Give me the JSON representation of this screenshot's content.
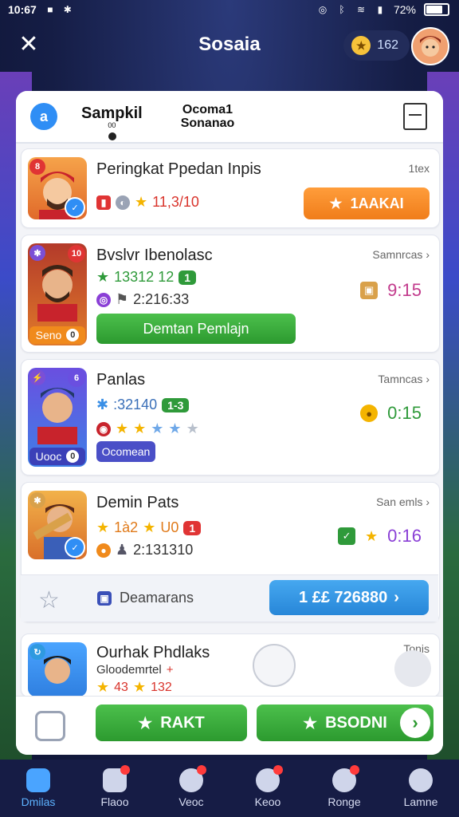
{
  "status_bar": {
    "time": "10:67",
    "battery": "72%"
  },
  "header": {
    "title": "Sosaia",
    "coins": "162"
  },
  "tabs": {
    "tab1_label": "Sampkil",
    "tab1_sub": "00",
    "tab2_line1": "Ocoma1",
    "tab2_line2": "Sonanao"
  },
  "cards": [
    {
      "title": "Peringkat Ppedan Inpis",
      "meta": "1tex",
      "stats": "11,3/10",
      "button": "1AAKAI"
    },
    {
      "title": "Bvslvr Ibenolasc",
      "meta": "Samnrcas",
      "line1": "13312 12",
      "line1_tag": "1",
      "line2": "2:216:33",
      "thumb_label": "Seno",
      "thumb_count": "0",
      "timer": "9:15",
      "button": "Demtan Pemlajn"
    },
    {
      "title": "Panlas",
      "meta": "Tamncas",
      "line1": ":32140",
      "line1_tag": "1-3",
      "thumb_label": "Uooc",
      "thumb_count": "0",
      "timer": "0:15",
      "button": "Ocomean"
    },
    {
      "title": "Demin Pats",
      "meta": "San emls",
      "line1": "1à2",
      "line1_b": "U0",
      "line1_tag": "1",
      "line2": "2:131310",
      "timer": "0:16"
    },
    {
      "title": "Ourhak Phdlaks",
      "subtitle": "Gloodemrtel",
      "meta": "Tonis",
      "line1": "43",
      "line1_b": "132"
    }
  ],
  "action_row": {
    "label": "Deamarans",
    "button": "1 ££ 726880"
  },
  "bottom_buttons": {
    "left": "RAKT",
    "right": "BSODNI"
  },
  "nav": [
    {
      "label": "Dmilas"
    },
    {
      "label": "Flaoo"
    },
    {
      "label": "Veoc"
    },
    {
      "label": "Keoo"
    },
    {
      "label": "Ronge"
    },
    {
      "label": "Lamne"
    }
  ],
  "colors": {
    "accent_green": "#2c9a2f",
    "accent_orange": "#f07d1a",
    "accent_blue": "#2786d8",
    "nav_bg": "#161c45"
  }
}
